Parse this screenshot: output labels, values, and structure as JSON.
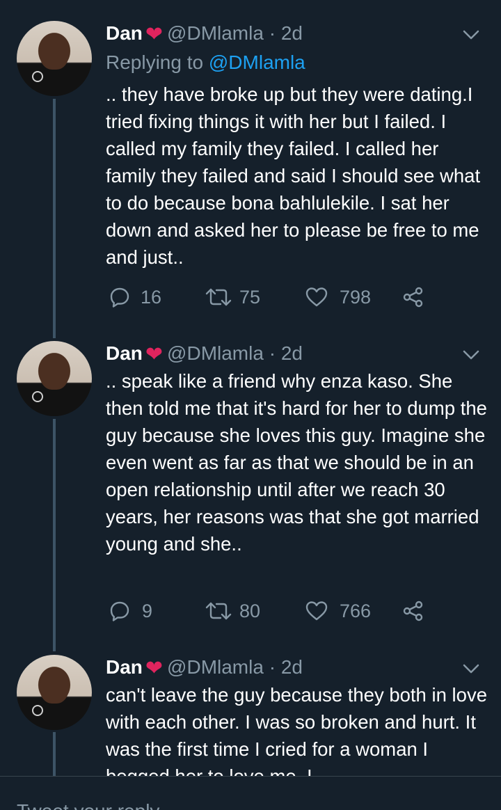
{
  "colors": {
    "background": "#15202b",
    "secondary_text": "#8899a6",
    "link": "#1da1f2",
    "heart": "#e0245e"
  },
  "tweets": [
    {
      "name": "Dan",
      "emoji": "❤️",
      "handle": "@DMlamla",
      "separator": "·",
      "time": "2d",
      "replying_prefix": "Replying to",
      "replying_to": "@DMlamla",
      "text": ".. they have broke up but they were dating.I tried fixing things it with her but I failed. I called my family they failed. I called her family they failed and said I should see what to do because bona bahlulekile. I sat her down and asked her to please be free to me and just..",
      "replies": "16",
      "retweets": "75",
      "likes": "798"
    },
    {
      "name": "Dan",
      "emoji": "❤️",
      "handle": "@DMlamla",
      "separator": "·",
      "time": "2d",
      "text": ".. speak like a friend why enza kaso. She then told me that it's hard for her to dump the guy because she loves this guy. Imagine she even went as far as that we should be in an open relationship until after we reach 30 years, her reasons was that she got married young and she..",
      "replies": "9",
      "retweets": "80",
      "likes": "766"
    },
    {
      "name": "Dan",
      "emoji": "❤️",
      "handle": "@DMlamla",
      "separator": "·",
      "time": "2d",
      "text": "can't leave the guy because they both in love with each other. I was so broken and hurt. It was the first time I cried for a woman I begged her to love me. I"
    }
  ],
  "reply_bar": {
    "placeholder": "Tweet your reply"
  }
}
